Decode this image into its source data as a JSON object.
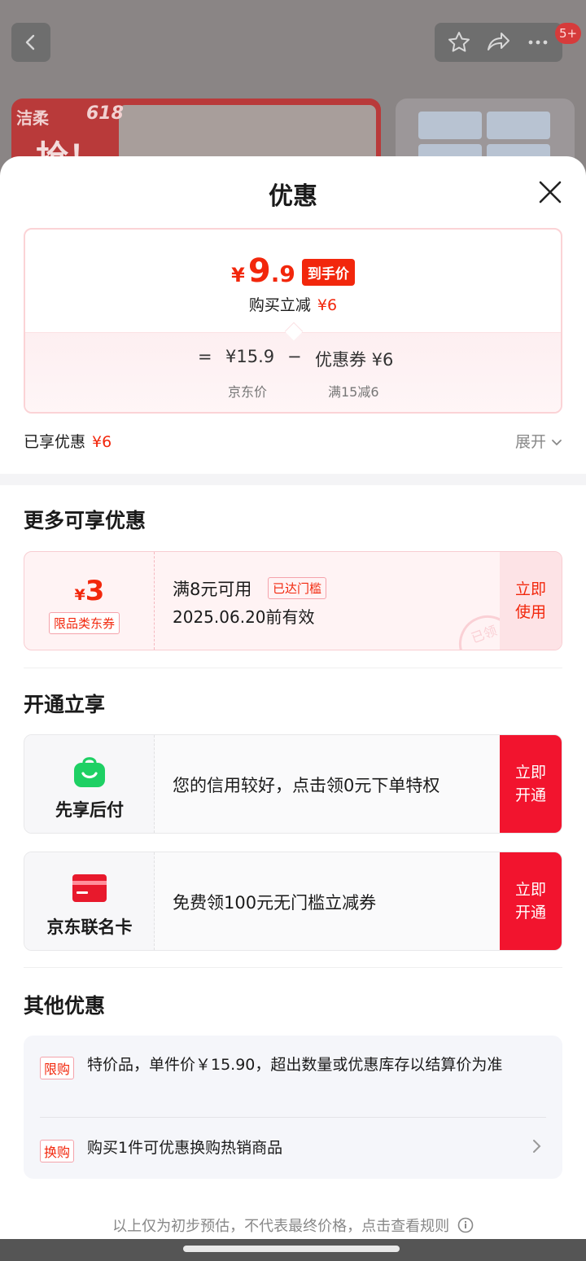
{
  "background": {
    "badge": "5+",
    "banner_brand": "洁柔",
    "banner_618": "618",
    "banner_big": "抢！"
  },
  "sheet": {
    "title": "优惠",
    "price": {
      "yen": "¥",
      "integer": "9",
      "decimal": ".9",
      "tag": "到手价",
      "sub_label": "购买立减",
      "sub_value": "¥6",
      "equals": "=",
      "jd_price": "¥15.9",
      "minus": "−",
      "coupon_text": "优惠券 ¥6",
      "jd_price_label": "京东价",
      "coupon_label": "满15减6"
    },
    "applied": {
      "label": "已享优惠",
      "value": "¥6",
      "expand": "展开"
    },
    "more": {
      "title": "更多可享优惠",
      "coupon": {
        "yen": "¥",
        "amount": "3",
        "kind": "限品类东券",
        "condition": "满8元可用",
        "reached": "已达门槛",
        "validity": "2025.06.20前有效",
        "button_line1": "立即",
        "button_line2": "使用",
        "stamp": "已领"
      }
    },
    "open": {
      "title": "开通立享",
      "offers": [
        {
          "name": "先享后付",
          "text": "您的信用较好，点击领0元下单特权",
          "button_line1": "立即",
          "button_line2": "开通"
        },
        {
          "name": "京东联名卡",
          "text": "免费领100元无门槛立减券",
          "button_line1": "立即",
          "button_line2": "开通"
        }
      ]
    },
    "other": {
      "title": "其他优惠",
      "items": [
        {
          "tag": "限购",
          "text": "特价品，单件价￥15.90，超出数量或优惠库存以结算价为准"
        },
        {
          "tag": "换购",
          "text": "购买1件可优惠换购热销商品"
        }
      ]
    },
    "footer": "以上仅为初步预估，不代表最终价格，点击查看规则"
  },
  "colors": {
    "accent_red": "#f2270c",
    "button_red": "#f2142e",
    "pay_green": "#1ed064",
    "card_red": "#e8192c"
  }
}
